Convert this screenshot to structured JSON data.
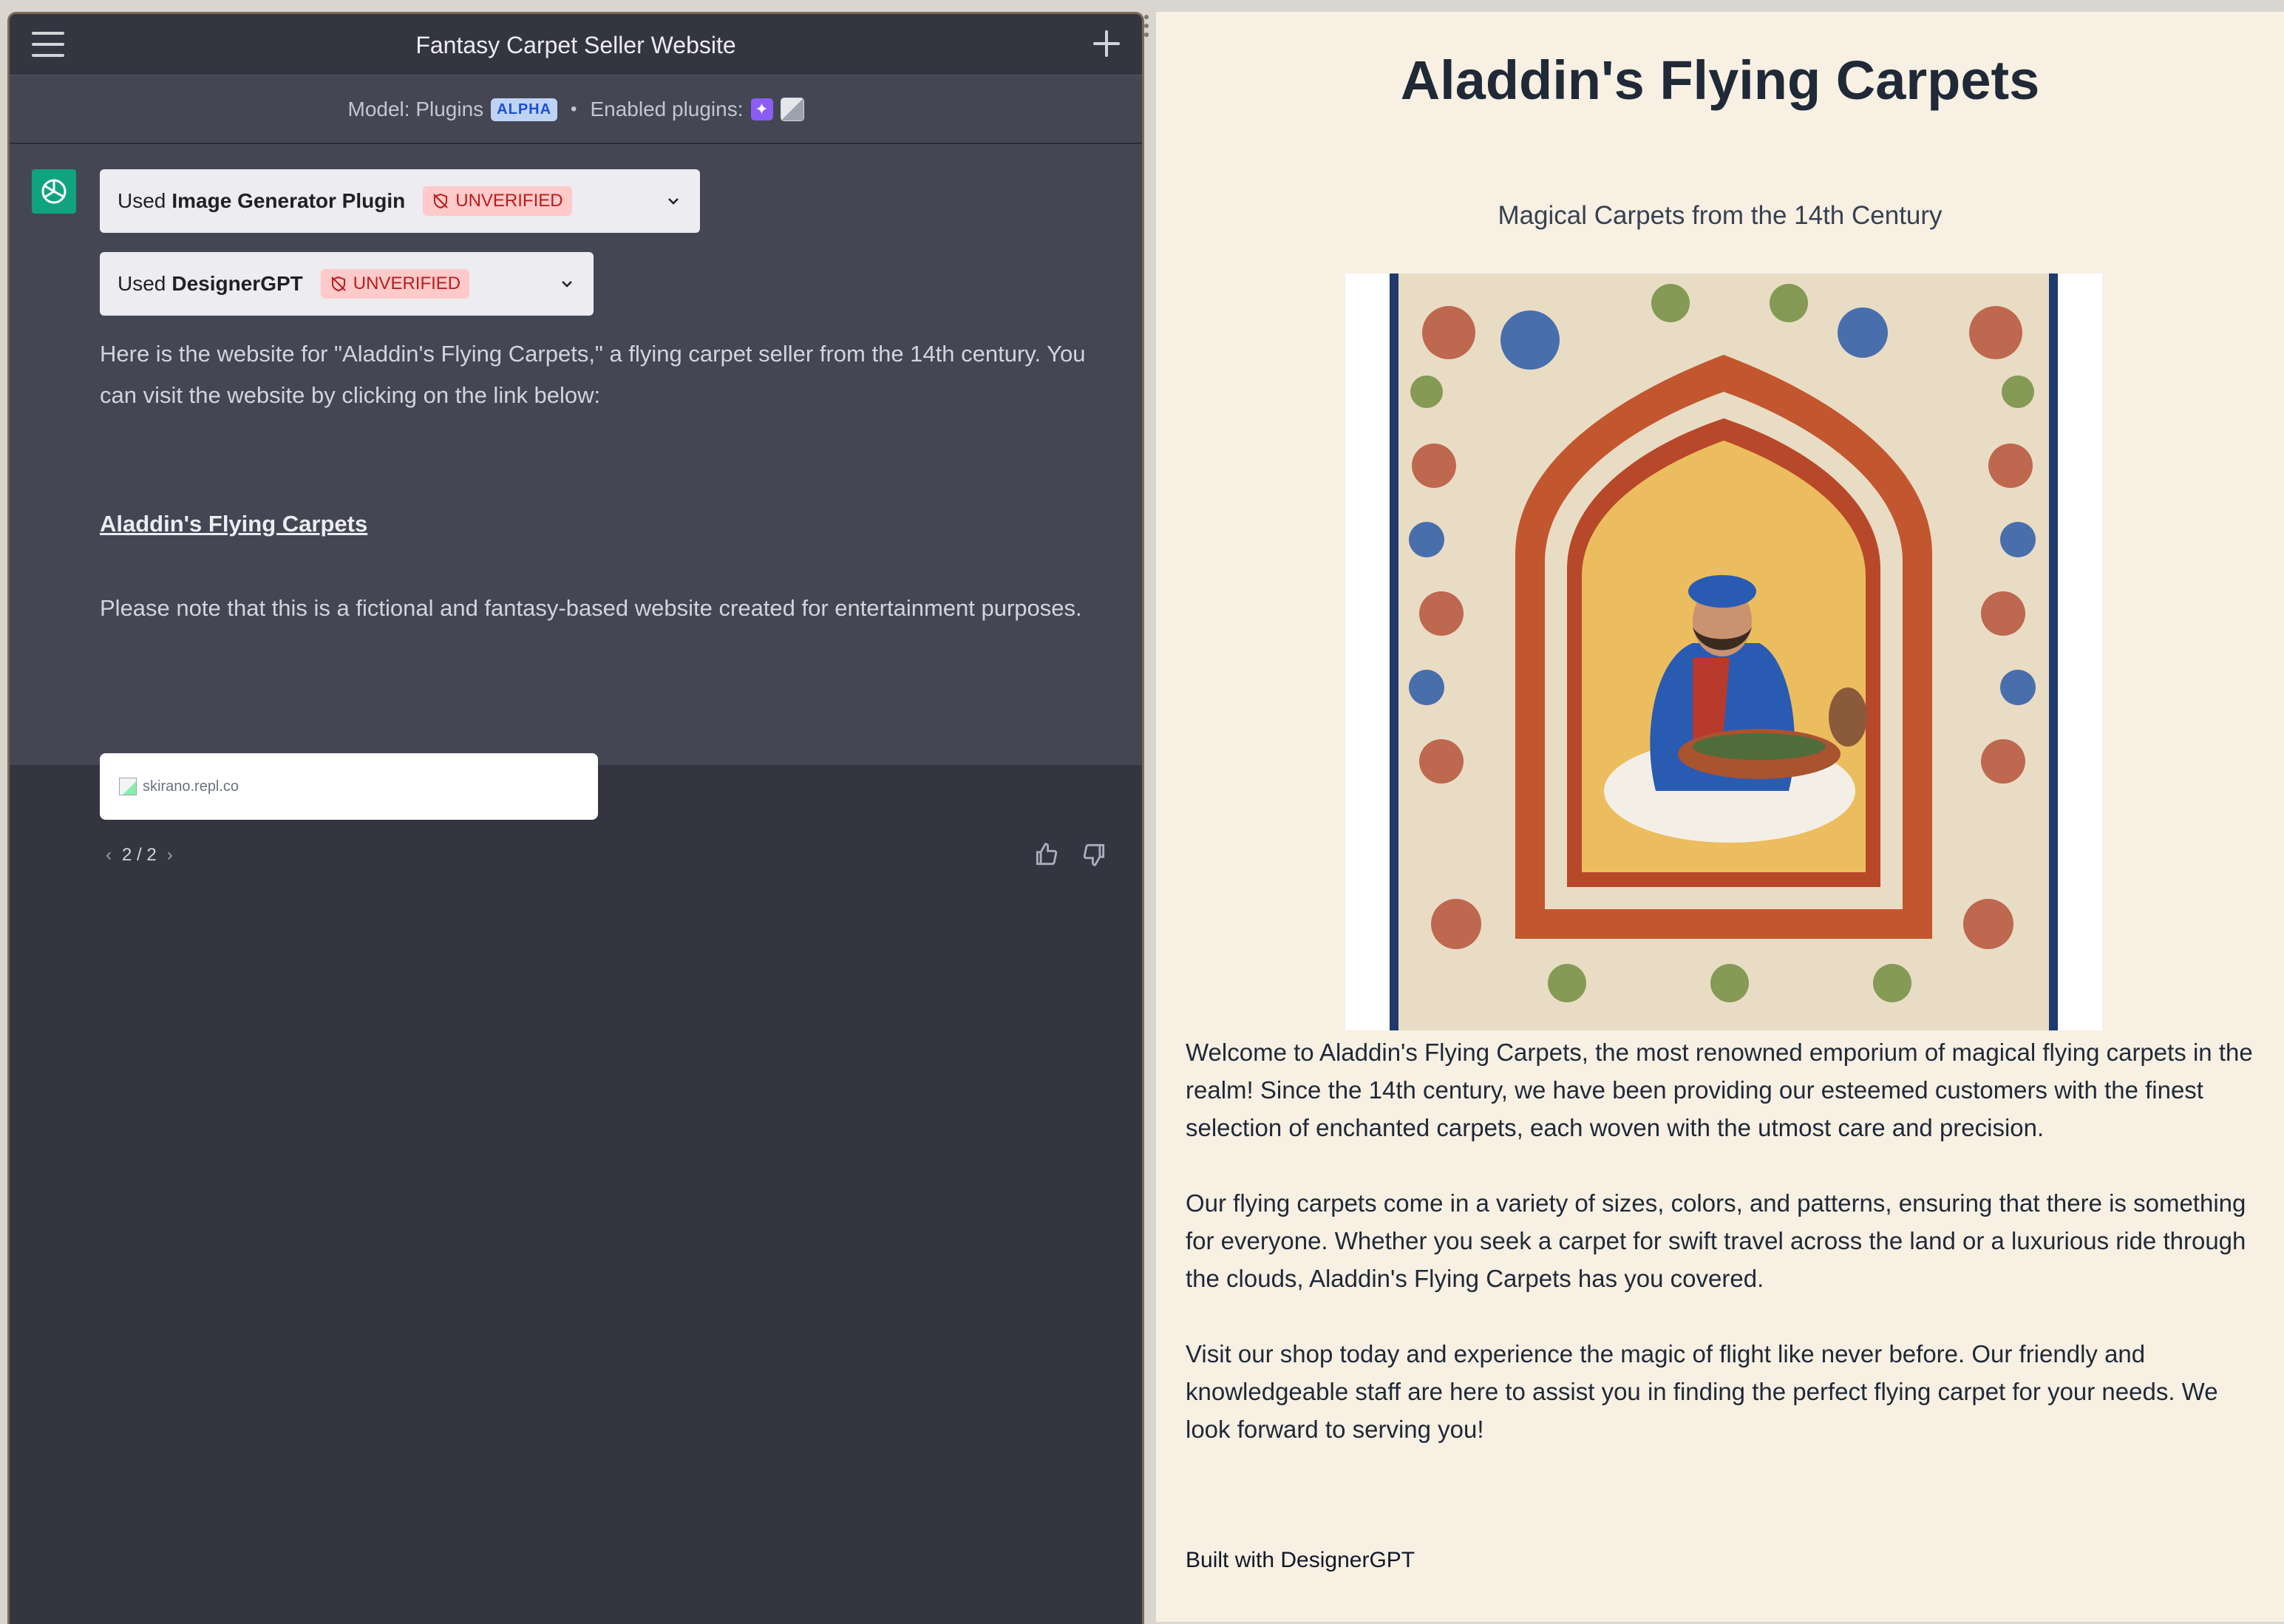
{
  "chat": {
    "title": "Fantasy Carpet Seller Website",
    "model_label": "Model: Plugins",
    "model_badge": "ALPHA",
    "separator": "•",
    "enabled_plugins_label": "Enabled plugins:",
    "plugins_used": [
      {
        "prefix": "Used",
        "name": "Image Generator Plugin",
        "status": "UNVERIFIED"
      },
      {
        "prefix": "Used",
        "name": "DesignerGPT",
        "status": "UNVERIFIED"
      }
    ],
    "message_p1": "Here is the website for \"Aladdin's Flying Carpets,\" a flying carpet seller from the 14th century. You can visit the website by clicking on the link below:",
    "link_text": "Aladdin's Flying Carpets",
    "message_p2": "Please note that this is a fictional and fantasy-based website created for entertainment purposes.",
    "preview_domain": "skirano.repl.co",
    "pager": "2 / 2"
  },
  "site": {
    "title": "Aladdin's Flying Carpets",
    "subtitle": "Magical Carpets from the 14th Century",
    "paragraphs": [
      "Welcome to Aladdin's Flying Carpets, the most renowned emporium of magical flying carpets in the realm! Since the 14th century, we have been providing our esteemed customers with the finest selection of enchanted carpets, each woven with the utmost care and precision.",
      "Our flying carpets come in a variety of sizes, colors, and patterns, ensuring that there is something for everyone. Whether you seek a carpet for swift travel across the land or a luxurious ride through the clouds, Aladdin's Flying Carpets has you covered.",
      "Visit our shop today and experience the magic of flight like never before. Our friendly and knowledgeable staff are here to assist you in finding the perfect flying carpet for your needs. We look forward to serving you!"
    ],
    "footer": "Built with DesignerGPT"
  },
  "colors": {
    "chat_bg": "#343541",
    "message_bg": "#444654",
    "site_bg": "#f7f0e3",
    "unverified_bg": "#fecaca",
    "unverified_text": "#b91c1c",
    "avatar_green": "#10a37f"
  },
  "icons": [
    "menu-icon",
    "plus-icon",
    "wand-icon",
    "image-icon",
    "openai-logo-icon",
    "shield-off-icon",
    "chevron-down-icon",
    "broken-image-icon",
    "chevron-left-icon",
    "chevron-right-icon",
    "thumbs-up-icon",
    "thumbs-down-icon"
  ]
}
